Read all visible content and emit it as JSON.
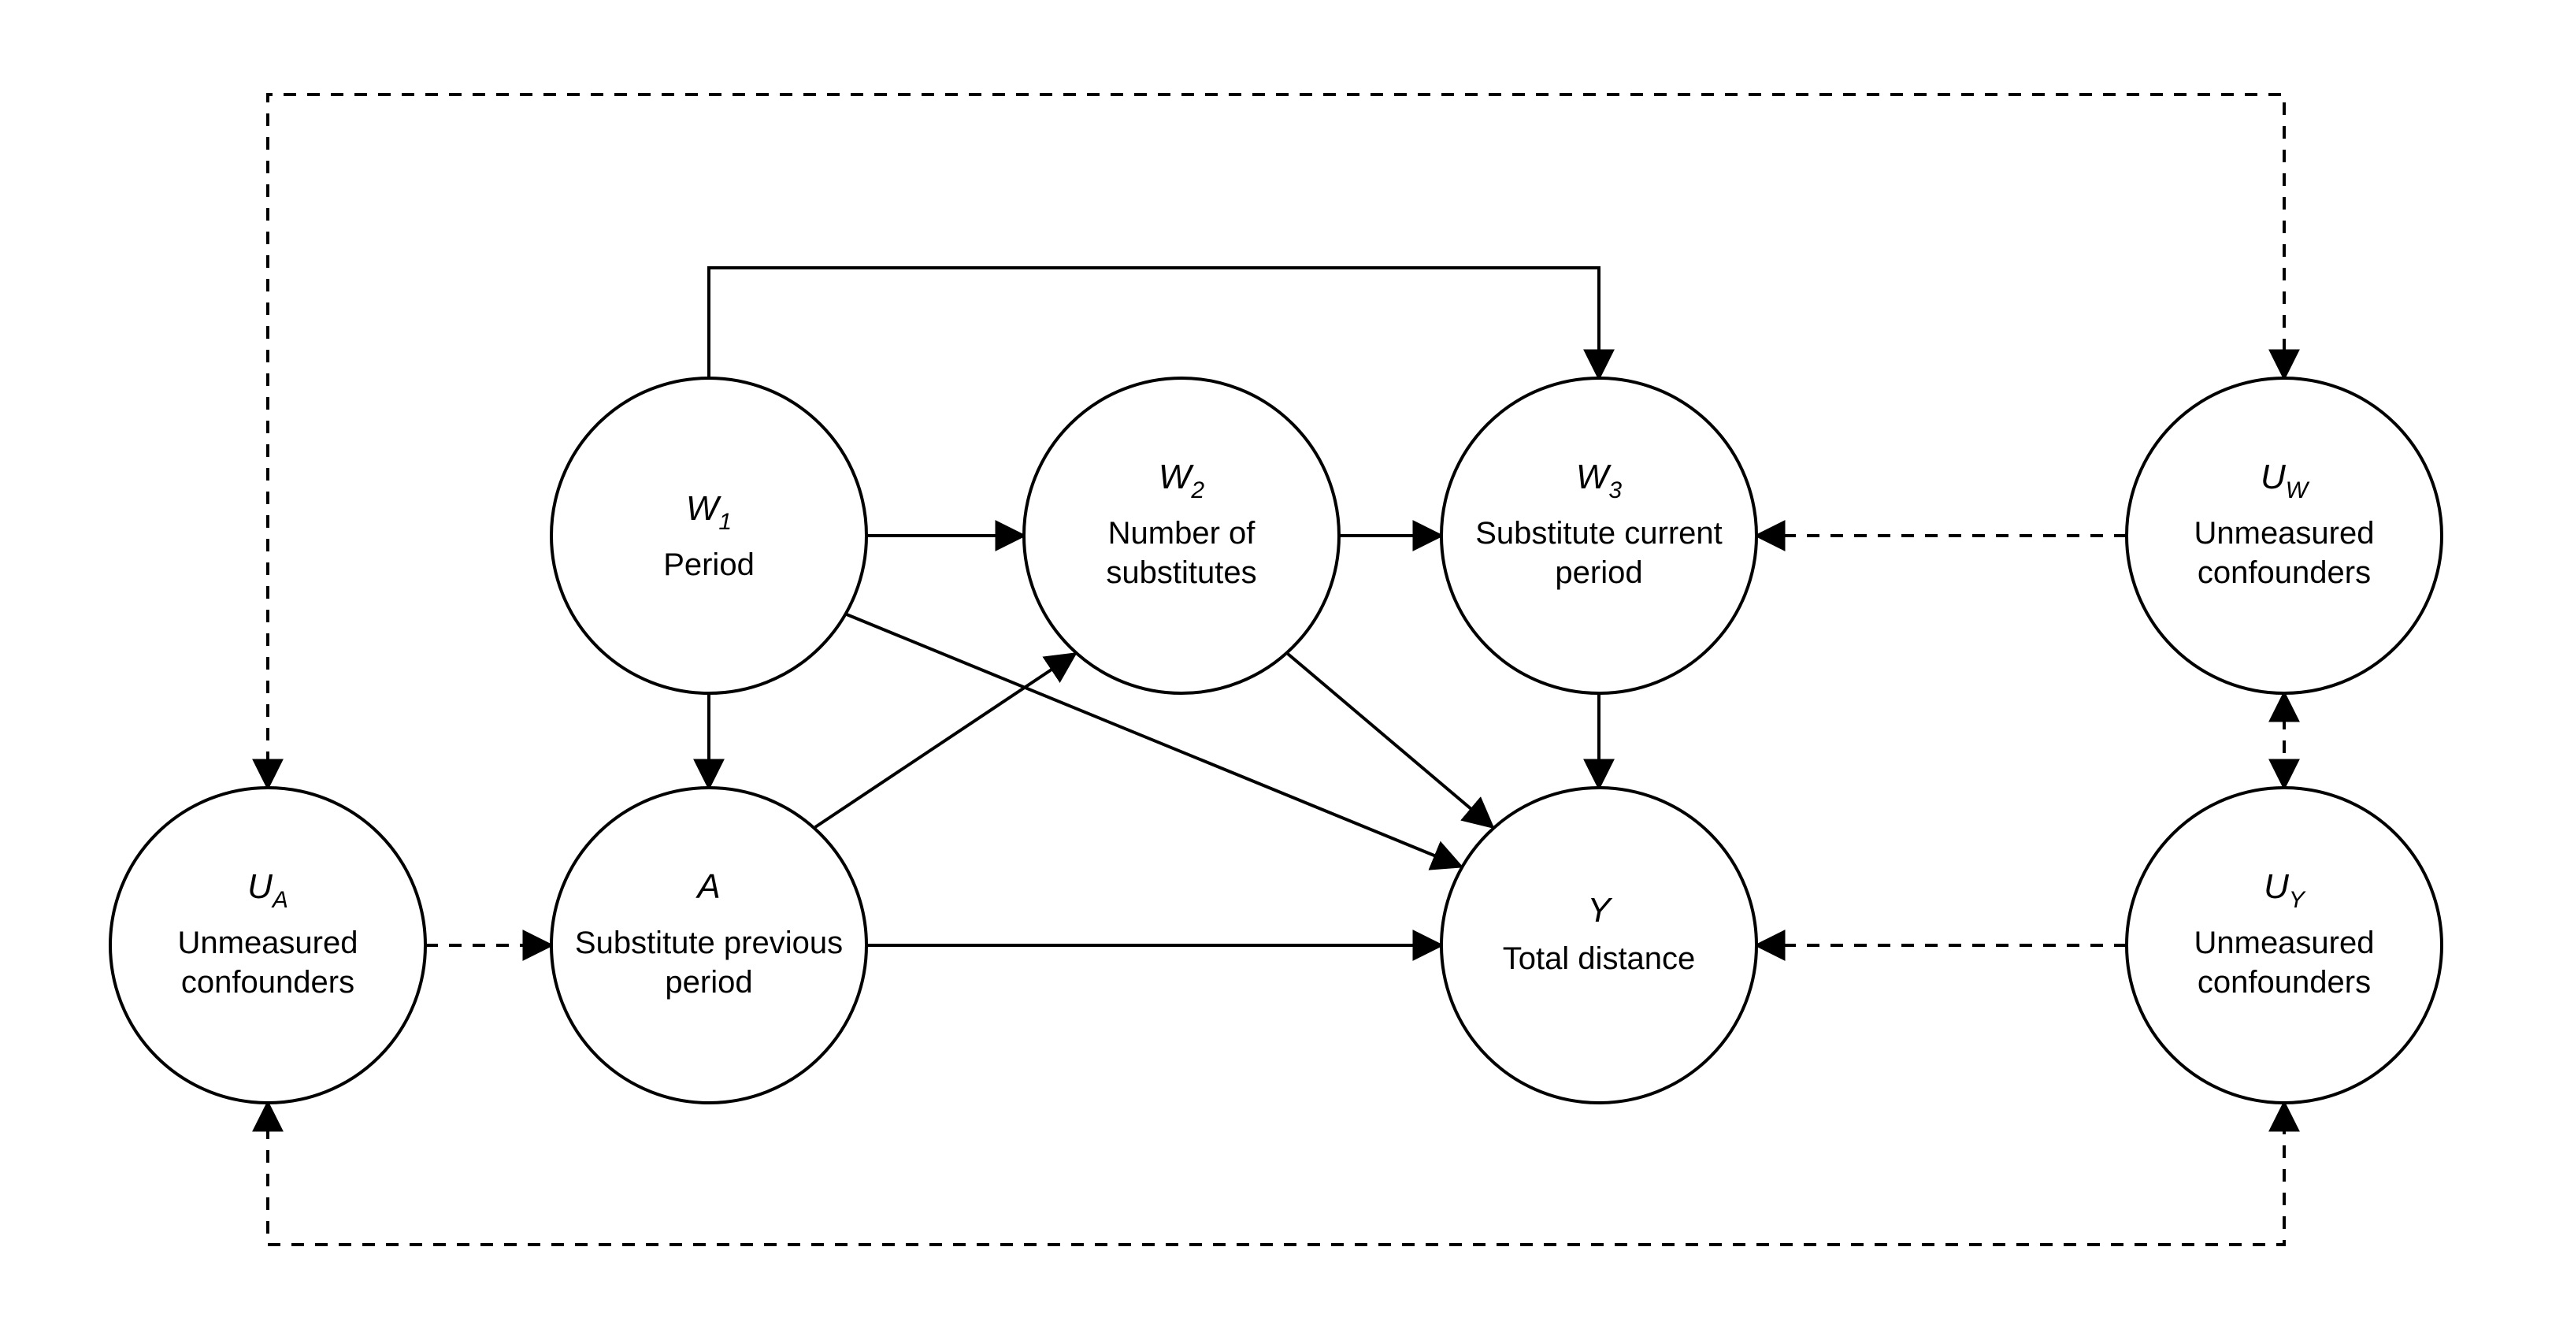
{
  "diagram": {
    "type": "DAG",
    "nodes": {
      "W1": {
        "symbol": "W",
        "subscript": "1",
        "label": "Period"
      },
      "W2": {
        "symbol": "W",
        "subscript": "2",
        "label1": "Number of",
        "label2": "substitutes"
      },
      "W3": {
        "symbol": "W",
        "subscript": "3",
        "label1": "Substitute current",
        "label2": "period"
      },
      "A": {
        "symbol": "A",
        "subscript": "",
        "label1": "Substitute previous",
        "label2": "period"
      },
      "Y": {
        "symbol": "Y",
        "subscript": "",
        "label": "Total distance"
      },
      "UA": {
        "symbol": "U",
        "subscript": "A",
        "label1": "Unmeasured",
        "label2": "confounders"
      },
      "UW": {
        "symbol": "U",
        "subscript": "W",
        "label1": "Unmeasured",
        "label2": "confounders"
      },
      "UY": {
        "symbol": "U",
        "subscript": "Y",
        "label1": "Unmeasured",
        "label2": "confounders"
      }
    },
    "edges_solid": [
      [
        "W1",
        "W2"
      ],
      [
        "W1",
        "W3"
      ],
      [
        "W1",
        "A"
      ],
      [
        "W1",
        "Y"
      ],
      [
        "W2",
        "W3"
      ],
      [
        "W2",
        "Y"
      ],
      [
        "W3",
        "Y"
      ],
      [
        "A",
        "W2"
      ],
      [
        "A",
        "Y"
      ]
    ],
    "edges_dashed": [
      [
        "UA",
        "A"
      ],
      [
        "UW",
        "W3"
      ],
      [
        "UY",
        "Y"
      ],
      [
        "UA",
        "UW"
      ],
      [
        "UA",
        "UY"
      ],
      [
        "UW",
        "UY"
      ]
    ]
  }
}
